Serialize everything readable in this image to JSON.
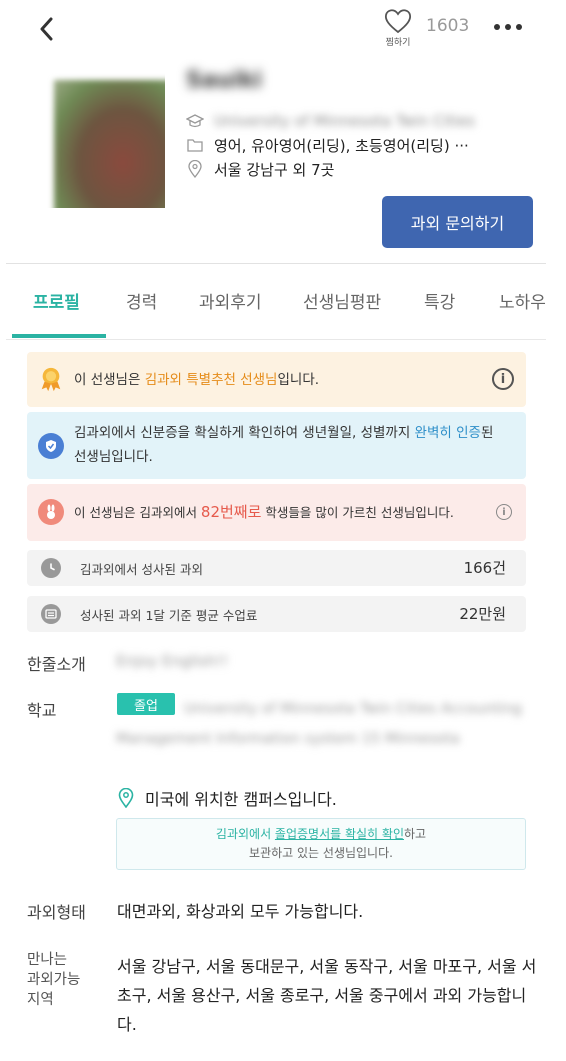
{
  "header": {
    "heart_label": "찜하기",
    "like_count": "1603"
  },
  "profile": {
    "name": "Sauiki",
    "school_line": "University of Minnesota Twin Cities",
    "subjects": "영어, 유아영어(리딩), 초등영어(리딩) ···",
    "location": "서울 강남구 외 7곳",
    "inquiry_button": "과외 문의하기"
  },
  "tabs": [
    {
      "label": "프로필",
      "active": true
    },
    {
      "label": "경력",
      "active": false
    },
    {
      "label": "과외후기",
      "active": false
    },
    {
      "label": "선생님평판",
      "active": false
    },
    {
      "label": "특강",
      "active": false
    },
    {
      "label": "노하우",
      "active": false
    }
  ],
  "badges": {
    "recommend": {
      "prefix": "이 선생님은 ",
      "highlight": "김과외 특별추천 선생님",
      "suffix": "입니다."
    },
    "verified": {
      "prefix": "김과외에서 신분증을 확실하게 확인하여 생년월일, 성별까지 ",
      "highlight": "완벽히 인증",
      "suffix": "된",
      "line2": "선생님입니다."
    },
    "rank": {
      "prefix": "이 선생님은 김과외에서 ",
      "highlight": "82번째로",
      "suffix": " 학생들을 많이 가르친 선생님입니다."
    }
  },
  "stats": [
    {
      "label": "김과외에서 성사된 과외",
      "value": "166건"
    },
    {
      "label": "성사된 과외 1달 기준 평균 수업료",
      "value": "22만원"
    }
  ],
  "sections": {
    "intro_label": "한줄소개",
    "intro_text": "Enjoy English!!",
    "school_label": "학교",
    "grad_badge": "졸업",
    "school_text": "University of Minnesota Twin Cities Accounting Management Information system 15 Minnesota",
    "campus_note": "미국에 위치한 캠퍼스입니다.",
    "cert": {
      "p1": "김과외에서 ",
      "t1": "졸업증명서를 확실히 확인",
      "p2": "하고",
      "line2": "보관하고 있는 선생님입니다."
    },
    "lesson_type_label": "과외형태",
    "lesson_type": "대면과외, 화상과외 모두 가능합니다.",
    "area_label_1": "만나는",
    "area_label_2": "과외가능",
    "area_label_3": "지역",
    "area_text": "서울 강남구, 서울 동대문구, 서울 동작구, 서울 마포구, 서울 서초구, 서울 용산구, 서울 종로구, 서울 중구에서 과외 가능합니다."
  },
  "colors": {
    "accent_teal": "#2bb3a3",
    "button_blue": "#3f66b0",
    "orange_highlight": "#e58c1a",
    "blue_highlight": "#2e8fc9",
    "red_highlight": "#e65a4c"
  }
}
